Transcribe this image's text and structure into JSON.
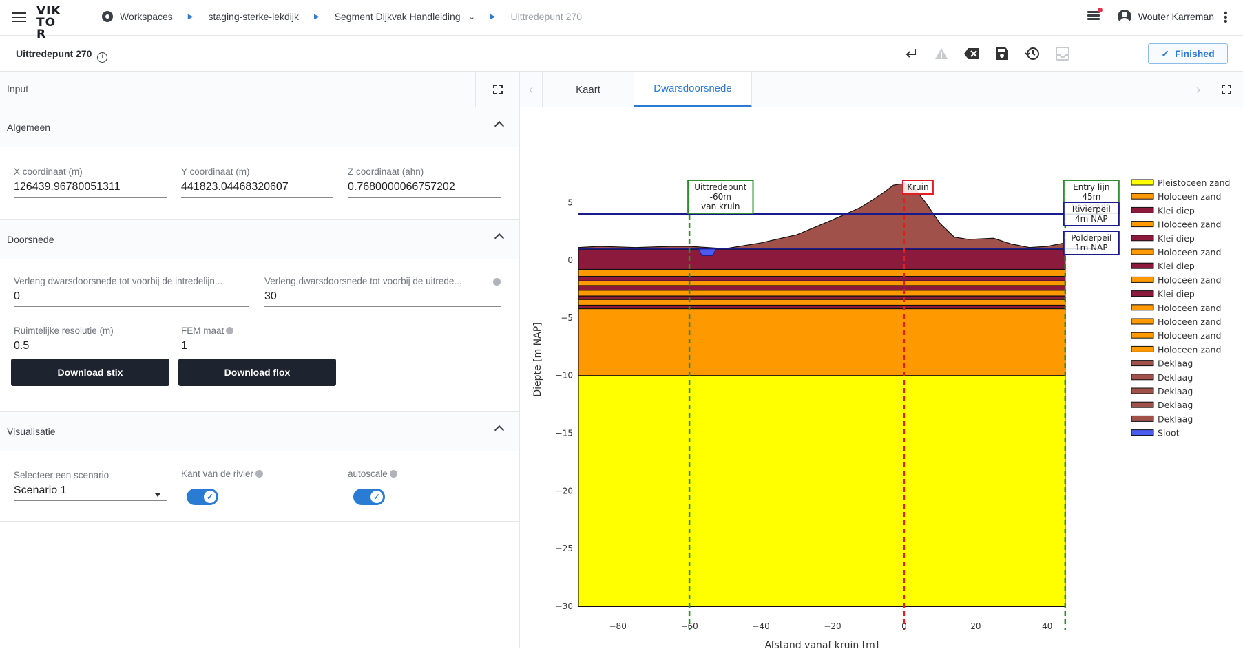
{
  "app": {
    "logo": "VIK TOR"
  },
  "breadcrumb": {
    "items": [
      "Workspaces",
      "staging-sterke-lekdijk",
      "Segment Dijkvak Handleiding",
      "Uittredepunt 270"
    ]
  },
  "user": {
    "name": "Wouter Karreman"
  },
  "entity": {
    "name": "Uittredepunt 270"
  },
  "actions": {
    "finished_label": "Finished"
  },
  "input_panel": {
    "title": "Input",
    "sections": {
      "algemeen": {
        "title": "Algemeen",
        "x_label": "X coordinaat (m)",
        "x_value": "126439.96780051311",
        "y_label": "Y coordinaat (m)",
        "y_value": "441823.04468320607",
        "z_label": "Z coordinaat (ahn)",
        "z_value": "0.7680000066757202"
      },
      "doorsnede": {
        "title": "Doorsnede",
        "intrede_label": "Verleng dwarsdoorsnede tot voorbij de intredelijn...",
        "intrede_value": "0",
        "uittrede_label": "Verleng dwarsdoorsnede tot voorbij de uitrede...",
        "uittrede_value": "30",
        "resolutie_label": "Ruimtelijke resolutie (m)",
        "resolutie_value": "0.5",
        "fem_label": "FEM maat",
        "fem_value": "1",
        "download_stix": "Download stix",
        "download_flox": "Download flox"
      },
      "visualisatie": {
        "title": "Visualisatie",
        "scenario_label": "Selecteer een scenario",
        "scenario_value": "Scenario 1",
        "kant_label": "Kant van de rivier",
        "kant_on": true,
        "autoscale_label": "autoscale",
        "autoscale_on": true
      }
    }
  },
  "view_tabs": [
    "Kaart",
    "Dwarsdoorsnede"
  ],
  "active_tab": "Dwarsdoorsnede",
  "chart_data": {
    "type": "area",
    "xlabel": "Afstand vanaf kruin [m]",
    "ylabel": "Diepte [m NAP]",
    "xlim": [
      -91,
      46
    ],
    "ylim": [
      -30,
      8
    ],
    "xticks": [
      -80,
      -60,
      -40,
      -20,
      0,
      20,
      40
    ],
    "yticks": [
      5,
      0,
      -5,
      -10,
      -15,
      -20,
      -25,
      -30
    ],
    "layers": [
      {
        "name": "Pleistoceen zand",
        "color": "#ffff00",
        "top": -10,
        "bottom": -30
      },
      {
        "name": "Holoceen zand",
        "color": "#ff9900",
        "top": -4.2,
        "bottom": -10
      },
      {
        "name": "Klei diep",
        "color": "#8b1a3c",
        "top": -3.9,
        "bottom": -4.2
      },
      {
        "name": "Holoceen zand",
        "color": "#ff9900",
        "top": -3.4,
        "bottom": -3.9
      },
      {
        "name": "Klei diep",
        "color": "#8b1a3c",
        "top": -3.1,
        "bottom": -3.4
      },
      {
        "name": "Holoceen zand",
        "color": "#ff9900",
        "top": -2.6,
        "bottom": -3.1
      },
      {
        "name": "Klei diep",
        "color": "#8b1a3c",
        "top": -2.2,
        "bottom": -2.6
      },
      {
        "name": "Holoceen zand",
        "color": "#ff9900",
        "top": -1.8,
        "bottom": -2.2
      },
      {
        "name": "Klei diep",
        "color": "#8b1a3c",
        "top": -1.4,
        "bottom": -1.8
      },
      {
        "name": "Holoceen zand",
        "color": "#ff9900",
        "top": -0.8,
        "bottom": -1.4
      },
      {
        "name": "Klei diep",
        "color": "#8b1a3c",
        "top": 0.9,
        "bottom": -0.8
      }
    ],
    "legend": [
      {
        "name": "Pleistoceen zand",
        "color": "#ffff00"
      },
      {
        "name": "Holoceen zand",
        "color": "#ff9900"
      },
      {
        "name": "Klei diep",
        "color": "#8b1a3c"
      },
      {
        "name": "Holoceen zand",
        "color": "#ff9900"
      },
      {
        "name": "Klei diep",
        "color": "#8b1a3c"
      },
      {
        "name": "Holoceen zand",
        "color": "#ff9900"
      },
      {
        "name": "Klei diep",
        "color": "#8b1a3c"
      },
      {
        "name": "Holoceen zand",
        "color": "#ff9900"
      },
      {
        "name": "Klei diep",
        "color": "#8b1a3c"
      },
      {
        "name": "Holoceen zand",
        "color": "#ff9900"
      },
      {
        "name": "Holoceen zand",
        "color": "#ff9900"
      },
      {
        "name": "Holoceen zand",
        "color": "#ff9900"
      },
      {
        "name": "Holoceen zand",
        "color": "#ff9900"
      },
      {
        "name": "Deklaag",
        "color": "#a0524a"
      },
      {
        "name": "Deklaag",
        "color": "#a0524a"
      },
      {
        "name": "Deklaag",
        "color": "#a0524a"
      },
      {
        "name": "Deklaag",
        "color": "#a0524a"
      },
      {
        "name": "Deklaag",
        "color": "#a0524a"
      },
      {
        "name": "Sloot",
        "color": "#4a5cf0"
      }
    ],
    "deklaag_surface": {
      "color": "#a0524a",
      "x": [
        -91,
        -85,
        -75,
        -65,
        -60,
        -50,
        -40,
        -30,
        -20,
        -12,
        -6,
        -3,
        -1,
        1,
        3,
        6,
        10,
        14,
        18,
        25,
        30,
        35,
        40,
        45
      ],
      "y": [
        1.1,
        1.2,
        1.1,
        1.2,
        1.2,
        1.0,
        1.5,
        2.2,
        3.5,
        4.6,
        5.8,
        6.5,
        6.6,
        6.6,
        6.2,
        5.0,
        3.2,
        2.0,
        1.8,
        1.9,
        1.4,
        1.1,
        1.2,
        1.5
      ]
    },
    "sloot": {
      "x": [
        -57.5,
        -56.5,
        -53.5,
        -52.5
      ],
      "y": [
        1.0,
        0.4,
        0.4,
        1.0
      ],
      "color": "#4a5cf0"
    },
    "hlines": [
      {
        "y": 4,
        "color": "#1a1a8c"
      },
      {
        "y": 1,
        "color": "#1a1a8c"
      }
    ],
    "vlines": [
      {
        "x": -60,
        "color": "#2e8b2e",
        "label": "Uittredepunt\n-60m\nvan kruin",
        "label_color": "#2e8b2e"
      },
      {
        "x": 0,
        "color": "#e02020",
        "label": "Kruin",
        "label_color": "#e02020"
      },
      {
        "x": 45,
        "color": "#2e8b2e",
        "label": "Entry lijn\n45m\nvan kruin",
        "label_color": "#2e8b2e"
      }
    ],
    "annotations": [
      {
        "text": "Rivierpeil\n4m NAP",
        "color": "#1a1a8c"
      },
      {
        "text": "Polderpeil\n1m NAP",
        "color": "#1a1a8c"
      }
    ]
  }
}
